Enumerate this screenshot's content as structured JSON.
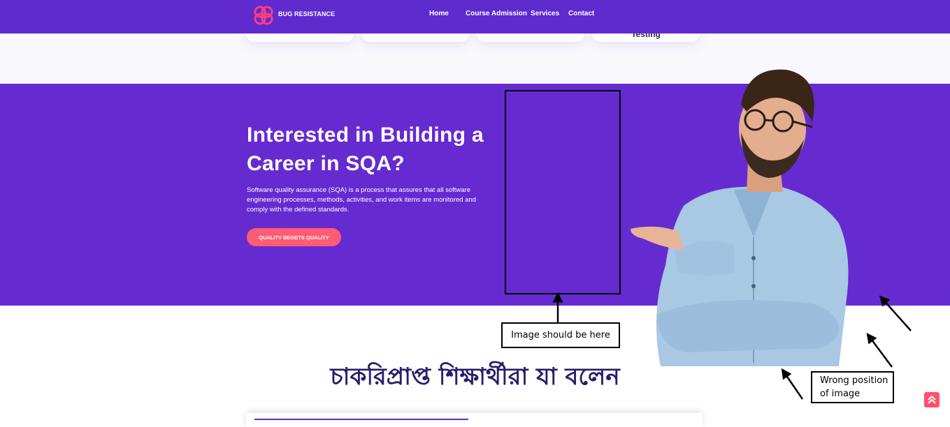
{
  "nav": {
    "brand": "BUG RESISTANCE",
    "links": [
      "Home",
      "Course Admission",
      "Services",
      "Contact"
    ]
  },
  "cards": [
    {
      "label": ""
    },
    {
      "label": ""
    },
    {
      "label": ""
    },
    {
      "label": "Testing"
    }
  ],
  "hero": {
    "title": "Interested in Building a Career in SQA?",
    "description": "Software quality assurance (SQA) is a process that assures that all software engineering processes, methods, activities, and work items are monitored and comply with the defined standards.",
    "cta_label": "QUALITY BEGETS QUALITY"
  },
  "annotations": {
    "placeholder_note": "Image should be here",
    "wrong_position_note": "Wrong position of image"
  },
  "testimonials": {
    "heading": "চাকরিপ্রাপ্ত শিক্ষার্থীরা যা বলেন"
  },
  "icons": {
    "logo": "infinity-knot-logo-icon",
    "scroll_top": "double-chevron-up-icon"
  },
  "colors": {
    "nav_bg": "#5f2bce",
    "hero_bg": "#652bd1",
    "cta": "#ff5c73",
    "heading": "#2a1d6a",
    "logo": "#ff3d7f"
  }
}
